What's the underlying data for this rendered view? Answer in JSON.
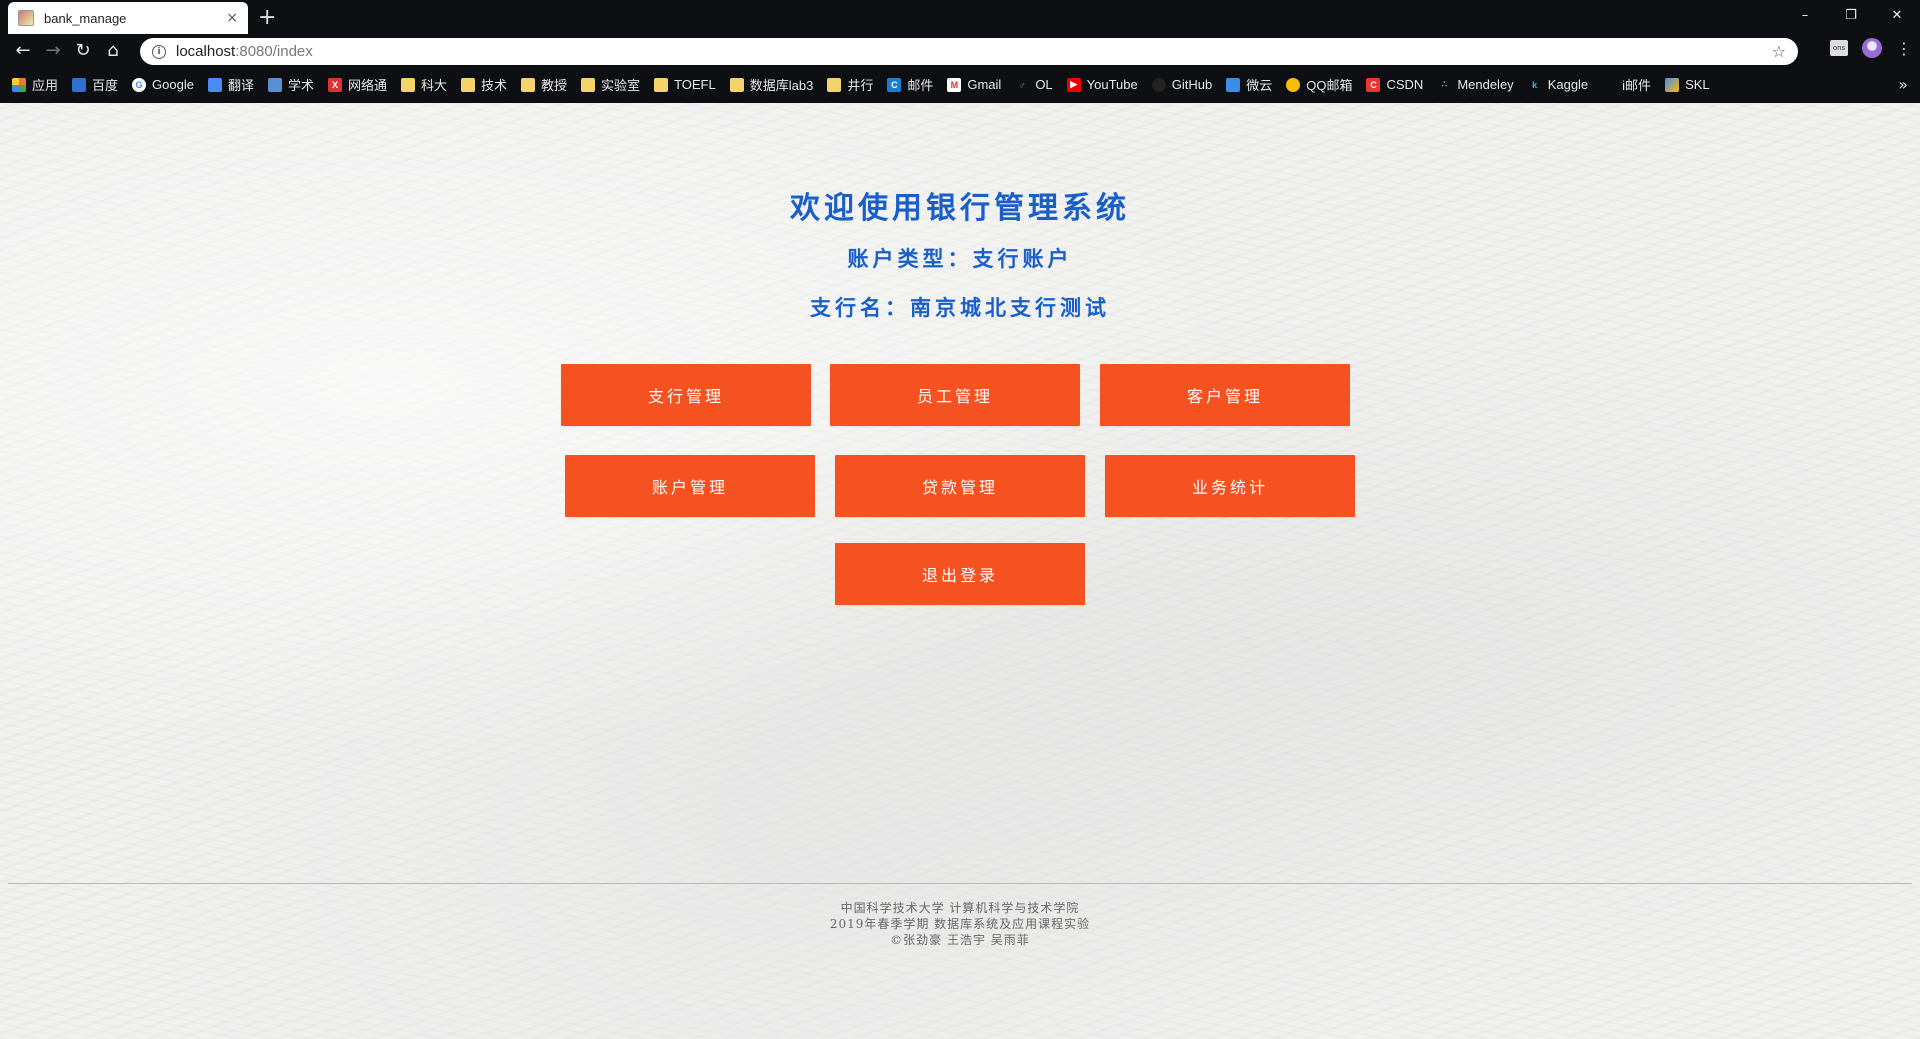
{
  "browser": {
    "tab_title": "bank_manage",
    "tab_close": "×",
    "new_tab": "+",
    "window_controls": [
      "–",
      "❐",
      "✕"
    ],
    "url_host": "localhost",
    "url_path": ":8080/index",
    "nav": {
      "back": "←",
      "forward": "→",
      "reload": "↻",
      "home": "⌂"
    },
    "star": "☆",
    "menu": "⋮",
    "ext_label": "ons",
    "bookmarks": [
      {
        "label": "应用",
        "icon": "apps-icon"
      },
      {
        "label": "百度",
        "icon": "baidu-icon"
      },
      {
        "label": "Google",
        "icon": "google-icon"
      },
      {
        "label": "翻译",
        "icon": "translate-icon"
      },
      {
        "label": "学术",
        "icon": "scholar-icon"
      },
      {
        "label": "网络通",
        "icon": "network-icon"
      },
      {
        "label": "科大",
        "icon": "folder-icon"
      },
      {
        "label": "技术",
        "icon": "folder-icon"
      },
      {
        "label": "教授",
        "icon": "folder-icon"
      },
      {
        "label": "实验室",
        "icon": "folder-icon"
      },
      {
        "label": "TOEFL",
        "icon": "folder-icon"
      },
      {
        "label": "数据库lab3",
        "icon": "folder-icon"
      },
      {
        "label": "井行",
        "icon": "folder-icon"
      },
      {
        "label": "邮件",
        "icon": "mail-c-icon"
      },
      {
        "label": "Gmail",
        "icon": "gmail-icon"
      },
      {
        "label": "OL",
        "icon": "ol-icon"
      },
      {
        "label": "YouTube",
        "icon": "youtube-icon"
      },
      {
        "label": "GitHub",
        "icon": "github-icon"
      },
      {
        "label": "微云",
        "icon": "weiyun-icon"
      },
      {
        "label": "QQ邮箱",
        "icon": "qqmail-icon"
      },
      {
        "label": "CSDN",
        "icon": "csdn-icon"
      },
      {
        "label": "Mendeley",
        "icon": "mendeley-icon"
      },
      {
        "label": "Kaggle",
        "icon": "kaggle-icon"
      },
      {
        "label": "i邮件",
        "icon": "apple-icon"
      },
      {
        "label": "SKL",
        "icon": "skl-icon"
      }
    ],
    "bookmarks_more": "»"
  },
  "header": {
    "welcome": "欢迎使用银行管理系统",
    "account_type": "账户类型：支行账户",
    "branch_name": "支行名：南京城北支行测试"
  },
  "buttons": {
    "branch": "支行管理",
    "staff": "员工管理",
    "customer": "客户管理",
    "account": "账户管理",
    "loan": "贷款管理",
    "stats": "业务统计",
    "logout": "退出登录"
  },
  "footer": {
    "line1": "中国科学技术大学  计算机科学与技术学院",
    "line2": "2019年春季学期  数据库系统及应用课程实验",
    "line3": "©张劲豪  王浩宇  吴雨菲"
  },
  "colors": {
    "accent_blue": "#1a5fc8",
    "button_orange": "#f65121"
  }
}
